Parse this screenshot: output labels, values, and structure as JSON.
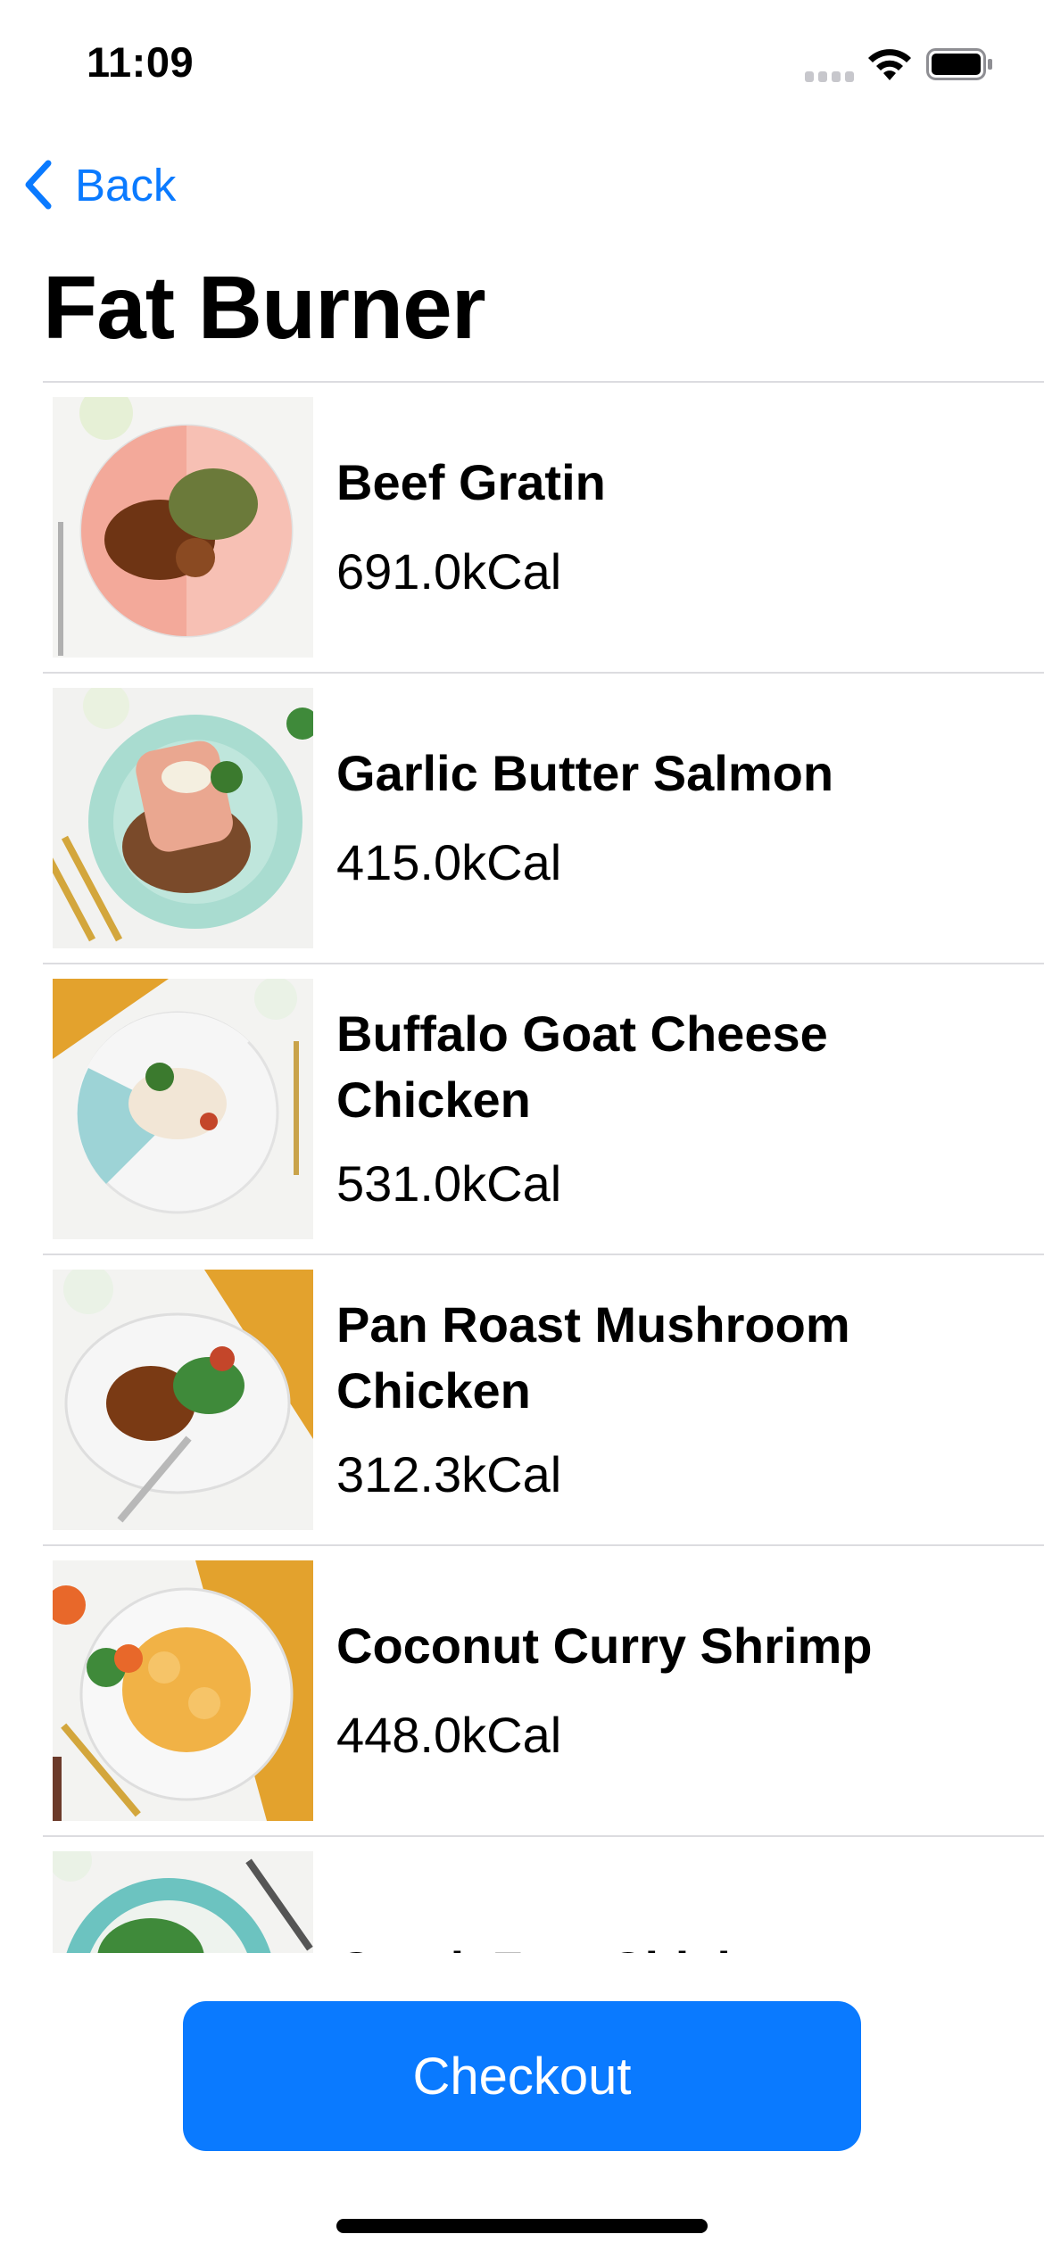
{
  "status_bar": {
    "time": "11:09"
  },
  "nav": {
    "back_label": "Back",
    "title": "Fat Burner"
  },
  "meals": [
    {
      "name": "Beef Gratin",
      "calories": "691.0kCal",
      "plate_color": "#f3a99a",
      "food_color": "#7a3a1c",
      "icon": "beef-gratin-photo"
    },
    {
      "name": "Garlic Butter Salmon",
      "calories": "415.0kCal",
      "plate_color": "#a9dcd0",
      "food_color": "#e9a88f",
      "icon": "garlic-butter-salmon-photo"
    },
    {
      "name": "Buffalo Goat Cheese Chicken",
      "calories": "531.0kCal",
      "plate_color": "#9dd3d6",
      "food_color": "#f0e6d8",
      "icon": "buffalo-goat-cheese-chicken-photo"
    },
    {
      "name": "Pan Roast Mushroom Chicken",
      "calories": "312.3kCal",
      "plate_color": "#f2f2f2",
      "food_color": "#8a4a1c",
      "icon": "pan-roast-mushroom-chicken-photo"
    },
    {
      "name": "Coconut Curry Shrimp",
      "calories": "448.0kCal",
      "plate_color": "#f4f4f4",
      "food_color": "#f1b246",
      "icon": "coconut-curry-shrimp-photo"
    },
    {
      "name": "Greek Feta Chicken",
      "calories": "",
      "plate_color": "#6cc3c0",
      "food_color": "#3f8a3a",
      "icon": "greek-feta-chicken-photo"
    }
  ],
  "checkout_label": "Checkout",
  "colors": {
    "accent": "#0a7aff",
    "separator": "#dcdce0"
  }
}
